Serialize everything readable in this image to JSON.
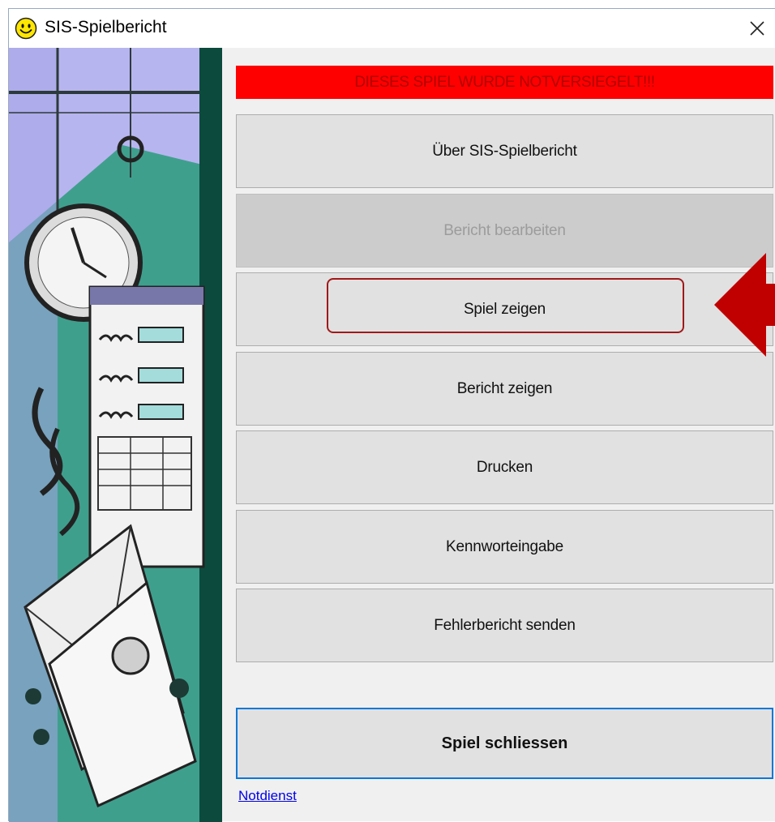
{
  "window": {
    "title": "SIS-Spielbericht"
  },
  "banner": {
    "text": "DIESES SPIEL WURDE NOTVERSIEGELT!!!"
  },
  "menu": [
    {
      "label": "Über SIS-Spielbericht",
      "enabled": true
    },
    {
      "label": "Bericht bearbeiten",
      "enabled": false
    },
    {
      "label": "Spiel zeigen",
      "enabled": true,
      "highlighted": true
    },
    {
      "label": "Bericht zeigen",
      "enabled": true
    },
    {
      "label": "Drucken",
      "enabled": true
    },
    {
      "label": "Kennworteingabe",
      "enabled": true
    },
    {
      "label": "Fehlerbericht senden",
      "enabled": true
    }
  ],
  "close_game": {
    "label": "Spiel schliessen"
  },
  "footer": {
    "link": "Notdienst"
  },
  "icons": {
    "app": "smiley-icon",
    "close": "close-icon",
    "pointer": "arrow-left-icon"
  },
  "colors": {
    "banner_bg": "#ff0000",
    "banner_text": "#b00000",
    "highlight": "#a11818",
    "arrow": "#c00000",
    "focus_border": "#0a78d7"
  }
}
